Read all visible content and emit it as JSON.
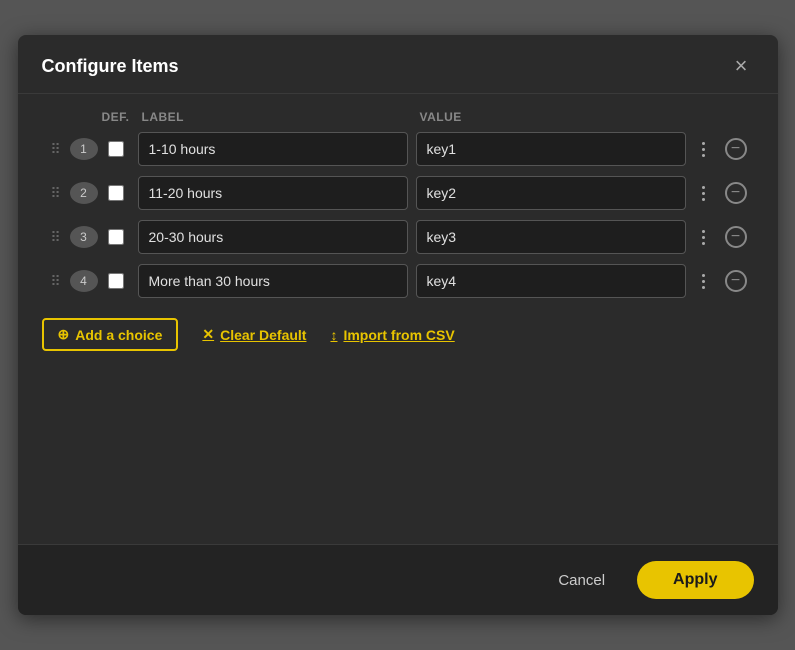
{
  "modal": {
    "title": "Configure Items",
    "close_label": "×"
  },
  "columns": {
    "def": "DEF.",
    "label": "LABEL",
    "value": "VALUE"
  },
  "rows": [
    {
      "num": "1",
      "label": "1-10 hours",
      "value": "key1"
    },
    {
      "num": "2",
      "label": "11-20 hours",
      "value": "key2"
    },
    {
      "num": "3",
      "label": "20-30 hours",
      "value": "key3"
    },
    {
      "num": "4",
      "label": "More than 30 hours",
      "value": "key4"
    }
  ],
  "actions": {
    "add_choice": "Add a choice",
    "clear_default": "Clear Default",
    "import_csv": "Import from CSV"
  },
  "footer": {
    "cancel": "Cancel",
    "apply": "Apply"
  }
}
